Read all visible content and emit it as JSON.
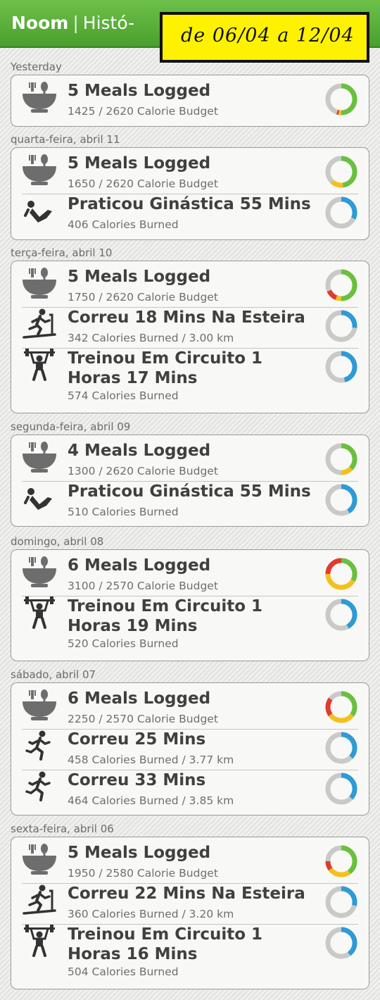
{
  "header": {
    "brand": "Noom",
    "separator": "|",
    "section": "Histó-"
  },
  "annotation": {
    "text": "de 06/04 a 12/04"
  },
  "colors": {
    "header_green": "#5bb13a",
    "ring_green": "#6abf3f",
    "ring_yellow": "#f4c01e",
    "ring_red": "#e23a2e",
    "ring_blue": "#2e9bd6",
    "ring_track": "#c9c9c9",
    "note_yellow": "#fff200"
  },
  "days": [
    {
      "label": "Yesterday",
      "entries": [
        {
          "icon": "meal-bowl-icon",
          "title": "5 Meals Logged",
          "subtitle": "1425 / 2620 Calorie Budget",
          "progress_ring": {
            "green": 0.5,
            "yellow": 0.03,
            "red": 0.02,
            "blue": 0
          }
        }
      ]
    },
    {
      "label": "quarta-feira, abril 11",
      "entries": [
        {
          "icon": "meal-bowl-icon",
          "title": "5 Meals Logged",
          "subtitle": "1650 / 2620 Calorie Budget",
          "progress_ring": {
            "green": 0.48,
            "yellow": 0.14,
            "red": 0,
            "blue": 0
          }
        },
        {
          "icon": "sit-up-exercise-icon",
          "title": "Praticou Ginástica 55 Mins",
          "subtitle": "406 Calories Burned",
          "progress_ring": {
            "green": 0,
            "yellow": 0,
            "red": 0,
            "blue": 0.32
          }
        }
      ]
    },
    {
      "label": "terça-feira, abril 10",
      "entries": [
        {
          "icon": "meal-bowl-icon",
          "title": "5 Meals Logged",
          "subtitle": "1750 / 2620 Calorie Budget",
          "progress_ring": {
            "green": 0.5,
            "yellow": 0.06,
            "red": 0.12,
            "blue": 0
          }
        },
        {
          "icon": "treadmill-icon",
          "title": "Correu 18 Mins Na Esteira",
          "subtitle": "342 Calories Burned / 3.00 km",
          "progress_ring": {
            "green": 0,
            "yellow": 0,
            "red": 0,
            "blue": 0.27
          }
        },
        {
          "icon": "weightlifting-icon",
          "title": "Treinou Em Circuito 1 Horas 17 Mins",
          "subtitle": "574 Calories Burned",
          "progress_ring": {
            "green": 0,
            "yellow": 0,
            "red": 0,
            "blue": 0.46
          }
        }
      ]
    },
    {
      "label": "segunda-feira, abril 09",
      "entries": [
        {
          "icon": "meal-bowl-icon",
          "title": "4 Meals Logged",
          "subtitle": "1300 / 2620 Calorie Budget",
          "progress_ring": {
            "green": 0.37,
            "yellow": 0.13,
            "red": 0,
            "blue": 0
          }
        },
        {
          "icon": "sit-up-exercise-icon",
          "title": "Praticou Ginástica 55 Mins",
          "subtitle": "510 Calories Burned",
          "progress_ring": {
            "green": 0,
            "yellow": 0,
            "red": 0,
            "blue": 0.41
          }
        }
      ]
    },
    {
      "label": "domingo, abril 08",
      "entries": [
        {
          "icon": "meal-bowl-icon",
          "title": "6 Meals Logged",
          "subtitle": "3100 / 2570 Calorie Budget",
          "progress_ring": {
            "green": 0.33,
            "yellow": 0.42,
            "red": 0.25,
            "blue": 0
          }
        },
        {
          "icon": "weightlifting-icon",
          "title": "Treinou Em Circuito 1 Horas 19 Mins",
          "subtitle": "520 Calories Burned",
          "progress_ring": {
            "green": 0,
            "yellow": 0,
            "red": 0,
            "blue": 0.42
          }
        }
      ]
    },
    {
      "label": "sábado, abril 07",
      "entries": [
        {
          "icon": "meal-bowl-icon",
          "title": "6 Meals Logged",
          "subtitle": "2250 / 2570 Calorie Budget",
          "progress_ring": {
            "green": 0.35,
            "yellow": 0.3,
            "red": 0.2,
            "blue": 0
          }
        },
        {
          "icon": "running-icon",
          "title": "Correu 25 Mins",
          "subtitle": "458 Calories Burned / 3.77 km",
          "progress_ring": {
            "green": 0,
            "yellow": 0,
            "red": 0,
            "blue": 0.37
          }
        },
        {
          "icon": "running-icon",
          "title": "Correu 33 Mins",
          "subtitle": "464 Calories Burned / 3.85 km",
          "progress_ring": {
            "green": 0,
            "yellow": 0,
            "red": 0,
            "blue": 0.37
          }
        }
      ]
    },
    {
      "label": "sexta-feira, abril 06",
      "entries": [
        {
          "icon": "meal-bowl-icon",
          "title": "5 Meals Logged",
          "subtitle": "1950 / 2580 Calorie Budget",
          "progress_ring": {
            "green": 0.4,
            "yellow": 0.25,
            "red": 0.1,
            "blue": 0
          }
        },
        {
          "icon": "treadmill-icon",
          "title": "Correu 22 Mins Na Esteira",
          "subtitle": "360 Calories Burned / 3.20 km",
          "progress_ring": {
            "green": 0,
            "yellow": 0,
            "red": 0,
            "blue": 0.29
          }
        },
        {
          "icon": "weightlifting-icon",
          "title": "Treinou Em Circuito 1 Horas 16 Mins",
          "subtitle": "504 Calories Burned",
          "progress_ring": {
            "green": 0,
            "yellow": 0,
            "red": 0,
            "blue": 0.4
          }
        }
      ]
    }
  ]
}
